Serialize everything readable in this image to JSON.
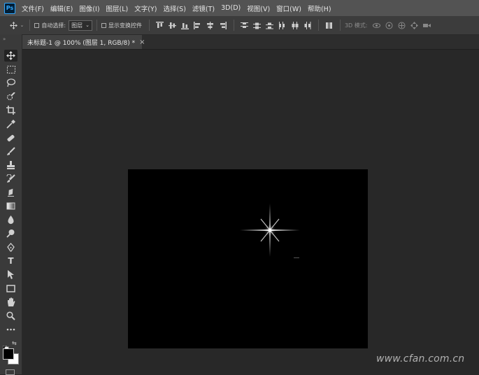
{
  "app": {
    "logo_text": "Ps"
  },
  "menu": [
    "文件(F)",
    "编辑(E)",
    "图像(I)",
    "图层(L)",
    "文字(Y)",
    "选择(S)",
    "滤镜(T)",
    "3D(D)",
    "视图(V)",
    "窗口(W)",
    "帮助(H)"
  ],
  "options": {
    "auto_select_label": "自动选择:",
    "auto_select_value": "图层",
    "show_transform_label": "显示变换控件",
    "mode_3d_label": "3D 模式:"
  },
  "tab": {
    "title": "未标题-1 @ 100% (图层 1, RGB/8) *",
    "close": "×"
  },
  "tools": [
    "move-icon",
    "marquee-icon",
    "lasso-icon",
    "quick-select-icon",
    "crop-icon",
    "eyedropper-icon",
    "healing-icon",
    "brush-icon",
    "clone-stamp-icon",
    "history-brush-icon",
    "eraser-icon",
    "gradient-icon",
    "blur-icon",
    "dodge-icon",
    "pen-icon",
    "type-icon",
    "path-select-icon",
    "rectangle-icon",
    "hand-icon",
    "zoom-icon",
    "more-icon"
  ],
  "type_tool_glyph": "T",
  "colors": {
    "foreground": "#000000",
    "background": "#ffffff",
    "canvas": "#000000",
    "workspace": "#282828"
  },
  "watermark": "www.cfan.com.cn"
}
